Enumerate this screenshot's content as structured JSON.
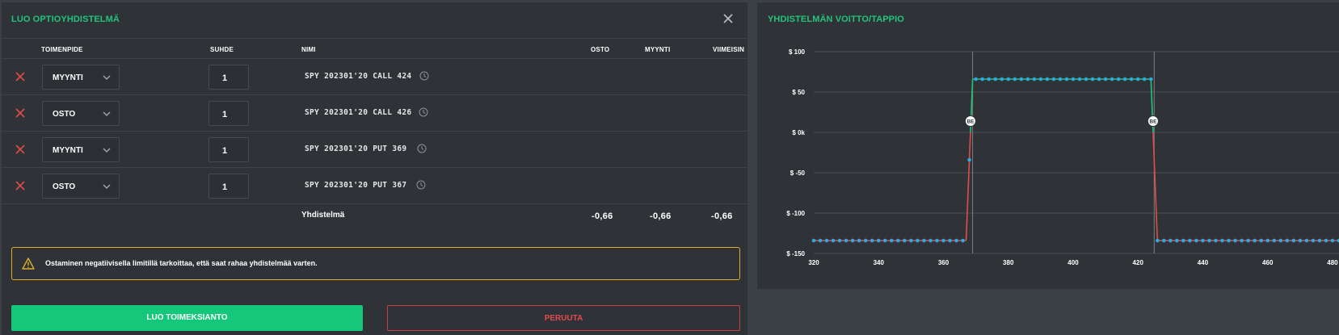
{
  "builder": {
    "title": "LUO OPTIOYHDISTELMÄ",
    "columns": {
      "action": "TOIMENPIDE",
      "ratio": "SUHDE",
      "name": "NIMI",
      "buy": "OSTO",
      "sell": "MYYNTI",
      "last": "VIIMEISIN"
    },
    "legs": [
      {
        "action": "MYYNTI",
        "ratio": "1",
        "name": "SPY 202301'20 CALL 424"
      },
      {
        "action": "OSTO",
        "ratio": "1",
        "name": "SPY 202301'20 CALL 426"
      },
      {
        "action": "MYYNTI",
        "ratio": "1",
        "name": "SPY 202301'20 PUT 369"
      },
      {
        "action": "OSTO",
        "ratio": "1",
        "name": "SPY 202301'20 PUT 367"
      }
    ],
    "combination": {
      "label": "Yhdistelmä",
      "buy": "-0,66",
      "sell": "-0,66",
      "last": "-0,66"
    },
    "warning": "Ostaminen negatiivisella limitillä tarkoittaa, että saat rahaa yhdistelmää varten.",
    "create_label": "LUO TOIMEKSIANTO",
    "cancel_label": "PERUUTA",
    "colors": {
      "accent": "#21c47a",
      "danger": "#e24b4a",
      "warning": "#e0ac2b"
    }
  },
  "chart": {
    "title": "YHDISTELMÄN VOITTO/TAPPIO"
  },
  "chart_data": {
    "type": "line",
    "title": "YHDISTELMÄN VOITTO/TAPPIO",
    "xlim": [
      320,
      482
    ],
    "ylim": [
      -150,
      100
    ],
    "x_ticks": [
      320,
      340,
      360,
      380,
      400,
      420,
      440,
      460,
      480
    ],
    "y_ticks": [
      {
        "value": 100,
        "label": "$ 100"
      },
      {
        "value": 50,
        "label": "$ 50"
      },
      {
        "value": 0,
        "label": "$ 0k"
      },
      {
        "value": -50,
        "label": "$ -50"
      },
      {
        "value": -100,
        "label": "$ -100"
      },
      {
        "value": -150,
        "label": "$ -150"
      }
    ],
    "grid": true,
    "series": [
      {
        "points": [
          [
            320,
            -134
          ],
          [
            367,
            -134
          ],
          [
            369,
            66
          ],
          [
            424,
            66
          ],
          [
            426,
            -134
          ],
          [
            482,
            -134
          ]
        ],
        "sample_step": 2
      }
    ],
    "extra_point": [
      368,
      -34
    ],
    "breakevens": [
      {
        "x": 368.34,
        "label": "BE"
      },
      {
        "x": 424.66,
        "label": "BE"
      }
    ],
    "vlines": [
      369,
      425
    ],
    "colors": {
      "marker": "#2fa7dc",
      "profit": "#21c47a",
      "loss": "#e24b4a",
      "grid": "#4a4f56"
    }
  }
}
